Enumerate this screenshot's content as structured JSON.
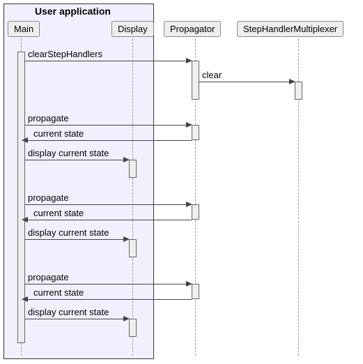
{
  "group": {
    "title": "User application"
  },
  "participants": {
    "main": "Main",
    "display": "Display",
    "propagator": "Propagator",
    "multiplexer": "StepHandlerMultiplexer"
  },
  "messages": {
    "clearStepHandlers": "clearStepHandlers",
    "clear": "clear",
    "propagate": "propagate",
    "currentState": "current state",
    "displayCurrentState": "display current state"
  },
  "chart_data": {
    "type": "sequence",
    "participants": [
      "Main",
      "Display",
      "Propagator",
      "StepHandlerMultiplexer"
    ],
    "group": {
      "name": "User application",
      "members": [
        "Main",
        "Display"
      ]
    },
    "interactions": [
      {
        "from": "Main",
        "to": "Propagator",
        "label": "clearStepHandlers",
        "kind": "sync"
      },
      {
        "from": "Propagator",
        "to": "StepHandlerMultiplexer",
        "label": "clear",
        "kind": "sync"
      },
      {
        "from": "Main",
        "to": "Propagator",
        "label": "propagate",
        "kind": "sync"
      },
      {
        "from": "Propagator",
        "to": "Main",
        "label": "current state",
        "kind": "return"
      },
      {
        "from": "Main",
        "to": "Display",
        "label": "display current state",
        "kind": "sync"
      },
      {
        "from": "Main",
        "to": "Propagator",
        "label": "propagate",
        "kind": "sync"
      },
      {
        "from": "Propagator",
        "to": "Main",
        "label": "current state",
        "kind": "return"
      },
      {
        "from": "Main",
        "to": "Display",
        "label": "display current state",
        "kind": "sync"
      },
      {
        "from": "Main",
        "to": "Propagator",
        "label": "propagate",
        "kind": "sync"
      },
      {
        "from": "Propagator",
        "to": "Main",
        "label": "current state",
        "kind": "return"
      },
      {
        "from": "Main",
        "to": "Display",
        "label": "display current state",
        "kind": "sync"
      }
    ]
  }
}
